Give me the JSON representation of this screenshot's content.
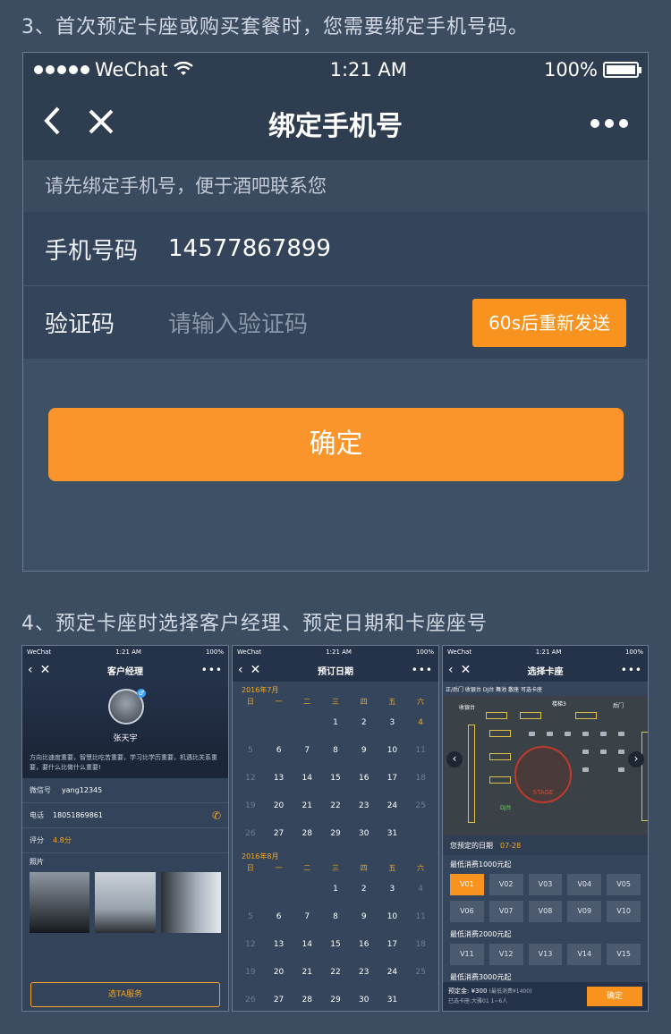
{
  "step3": {
    "title": "3、首次预定卡座或购买套餐时，您需要绑定手机号码。"
  },
  "phone": {
    "status": {
      "carrier": "WeChat",
      "time": "1:21 AM",
      "battery": "100%"
    },
    "nav": {
      "back_icon": "chevron-left",
      "close_icon": "close",
      "title": "绑定手机号",
      "more_icon": "more-dots"
    },
    "hint": "请先绑定手机号，便于酒吧联系您",
    "phone_field": {
      "label": "手机号码",
      "value": "14577867899"
    },
    "code_field": {
      "label": "验证码",
      "placeholder": "请输入验证码"
    },
    "resend_label": "60s后重新发送",
    "confirm_label": "确定"
  },
  "step4": {
    "title": "4、预定卡座时选择客户经理、预定日期和卡座座号"
  },
  "screen_manager": {
    "status": {
      "carrier": "WeChat",
      "time": "1:21 AM",
      "battery": "100%"
    },
    "title": "客户经理",
    "name": "张天宇",
    "bio": "方向比速度重要，智慧比吃苦重要，学习比学历重要，机遇比关系重要，要什么比做什么重要!",
    "wechat": {
      "label": "微信号",
      "value": "yang12345"
    },
    "tel": {
      "label": "电话",
      "value": "18051869861"
    },
    "rating": {
      "label": "评分",
      "value": "4.8分"
    },
    "photos_label": "照片",
    "select_label": "选TA服务"
  },
  "screen_calendar": {
    "status": {
      "carrier": "WeChat",
      "time": "1:21 AM",
      "battery": "100%"
    },
    "title": "预订日期",
    "weekdays": [
      "日",
      "一",
      "二",
      "三",
      "四",
      "五",
      "六"
    ],
    "months": [
      {
        "label": "2016年7月",
        "days": [
          "",
          "",
          "",
          "1",
          "2",
          "3",
          "4",
          "5",
          "6",
          "7",
          "8",
          "9",
          "10",
          "11",
          "12",
          "13",
          "14",
          "15",
          "16",
          "17",
          "18",
          "19",
          "20",
          "21",
          "22",
          "23",
          "24",
          "25",
          "26",
          "27",
          "28",
          "29",
          "30",
          "31"
        ]
      },
      {
        "label": "2016年8月",
        "days": [
          "",
          "",
          "",
          "1",
          "2",
          "3",
          "4",
          "5",
          "6",
          "7",
          "8",
          "9",
          "10",
          "11",
          "12",
          "13",
          "14",
          "15",
          "16",
          "17",
          "18",
          "19",
          "20",
          "21",
          "22",
          "23",
          "24",
          "25",
          "26",
          "27",
          "28",
          "29",
          "30",
          "31"
        ]
      }
    ]
  },
  "screen_seats": {
    "status": {
      "carrier": "WeChat",
      "time": "1:21 AM",
      "battery": "100%"
    },
    "title": "选择卡座",
    "legend": "正/后门  收银台  DJ台  舞池  散座  可选卡座",
    "map_labels": {
      "cashier": "收银台",
      "stairs": "楼梯3",
      "back_door": "后门",
      "stage": "STAGE",
      "dj": "DJ台"
    },
    "date_label": "您预定的日期",
    "date_value": "07-28",
    "categories": [
      {
        "label": "最低消费1000元起",
        "seats": [
          "V01",
          "V02",
          "V03",
          "V04",
          "V05",
          "V06",
          "V07",
          "V08",
          "V09",
          "V10"
        ]
      },
      {
        "label": "最低消费2000元起",
        "seats": [
          "V11",
          "V12",
          "V13",
          "V14",
          "V15"
        ]
      },
      {
        "label": "最低消费3000元起",
        "seats": []
      }
    ],
    "footer": {
      "deposit": "预定金: ¥300",
      "min_note": "(最低消费¥1400)",
      "selected": "已选卡座:大雅01 1~6人",
      "confirm": "确定"
    }
  }
}
